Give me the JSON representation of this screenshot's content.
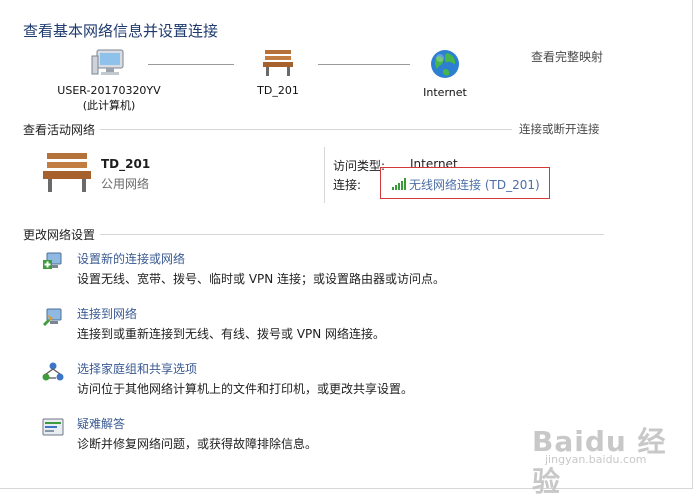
{
  "header": {
    "title": "查看基本网络信息并设置连接",
    "full_map_link": "查看完整映射"
  },
  "network_map": {
    "computer": {
      "name": "USER-20170320YV",
      "sub": "(此计算机)"
    },
    "network": {
      "name": "TD_201"
    },
    "internet": {
      "name": "Internet"
    }
  },
  "active": {
    "heading": "查看活动网络",
    "connect_link": "连接或断开连接",
    "network_name": "TD_201",
    "network_type": "公用网络",
    "access_type_label": "访问类型:",
    "access_type_value": "Internet",
    "connection_label": "连接:",
    "connection_value": "无线网络连接 (TD_201)"
  },
  "settings": {
    "heading": "更改网络设置",
    "tasks": [
      {
        "title": "设置新的连接或网络",
        "desc": "设置无线、宽带、拨号、临时或 VPN 连接；或设置路由器或访问点。"
      },
      {
        "title": "连接到网络",
        "desc": "连接到或重新连接到无线、有线、拨号或 VPN 网络连接。"
      },
      {
        "title": "选择家庭组和共享选项",
        "desc": "访问位于其他网络计算机上的文件和打印机，或更改共享设置。"
      },
      {
        "title": "疑难解答",
        "desc": "诊断并修复网络问题，或获得故障排除信息。"
      }
    ]
  },
  "watermark": {
    "brand": "Baidu 经验",
    "url": "jingyan.baidu.com"
  },
  "colors": {
    "title": "#1e3a6e",
    "link": "#3a5a92",
    "highlight_box": "#d23a3a"
  }
}
